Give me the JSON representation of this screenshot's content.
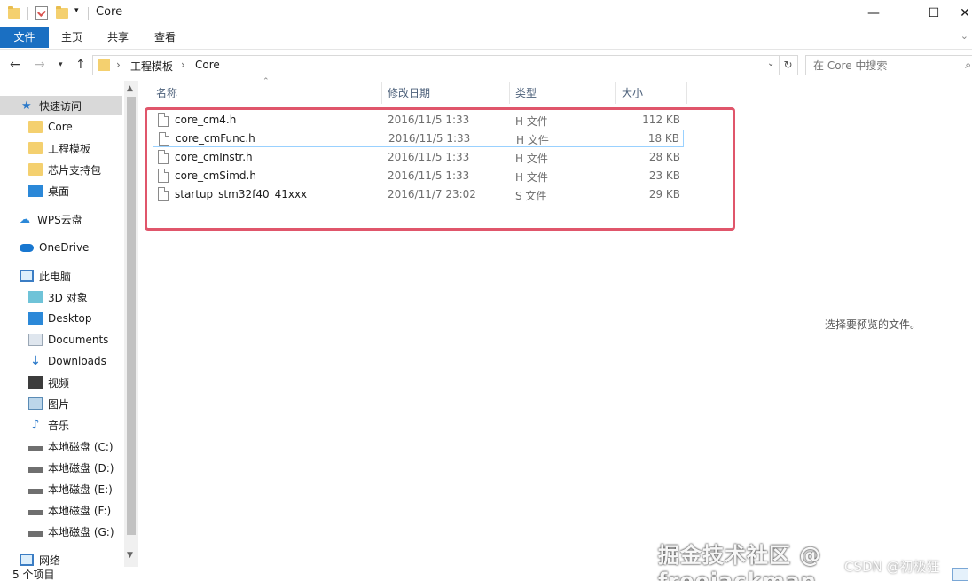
{
  "window": {
    "title": "Core",
    "controls": {
      "minimize": "—",
      "maximize": "☐",
      "close": "✕"
    }
  },
  "ribbon": {
    "tabs": [
      "文件",
      "主页",
      "共享",
      "查看"
    ]
  },
  "address": {
    "crumbs": [
      "工程模板",
      "Core"
    ],
    "search_placeholder": "在 Core 中搜索"
  },
  "sidebar": {
    "items": [
      {
        "label": "快速访问",
        "icon": "star-icon"
      },
      {
        "label": "Core",
        "icon": "folder-icon"
      },
      {
        "label": "工程模板",
        "icon": "folder-icon"
      },
      {
        "label": "芯片支持包",
        "icon": "folder-icon"
      },
      {
        "label": "桌面",
        "icon": "desktop-icon"
      },
      {
        "label": "WPS云盘",
        "icon": "cloud-icon"
      },
      {
        "label": "OneDrive",
        "icon": "onedrive-icon"
      },
      {
        "label": "此电脑",
        "icon": "pc-icon"
      },
      {
        "label": "3D 对象",
        "icon": "cube-icon"
      },
      {
        "label": "Desktop",
        "icon": "desktop-icon"
      },
      {
        "label": "Documents",
        "icon": "documents-icon"
      },
      {
        "label": "Downloads",
        "icon": "download-icon"
      },
      {
        "label": "视频",
        "icon": "video-icon"
      },
      {
        "label": "图片",
        "icon": "pictures-icon"
      },
      {
        "label": "音乐",
        "icon": "music-icon"
      },
      {
        "label": "本地磁盘 (C:)",
        "icon": "drive-icon"
      },
      {
        "label": "本地磁盘 (D:)",
        "icon": "drive-icon"
      },
      {
        "label": "本地磁盘 (E:)",
        "icon": "drive-icon"
      },
      {
        "label": "本地磁盘 (F:)",
        "icon": "drive-icon"
      },
      {
        "label": "本地磁盘 (G:)",
        "icon": "drive-icon"
      },
      {
        "label": "网络",
        "icon": "network-icon"
      }
    ]
  },
  "columns": {
    "name": "名称",
    "date": "修改日期",
    "type": "类型",
    "size": "大小"
  },
  "files": [
    {
      "name": "core_cm4.h",
      "date": "2016/11/5 1:33",
      "type": "H 文件",
      "size": "112 KB"
    },
    {
      "name": "core_cmFunc.h",
      "date": "2016/11/5 1:33",
      "type": "H 文件",
      "size": "18 KB"
    },
    {
      "name": "core_cmInstr.h",
      "date": "2016/11/5 1:33",
      "type": "H 文件",
      "size": "28 KB"
    },
    {
      "name": "core_cmSimd.h",
      "date": "2016/11/5 1:33",
      "type": "H 文件",
      "size": "23 KB"
    },
    {
      "name": "startup_stm32f40_41xxx",
      "date": "2016/11/7 23:02",
      "type": "S 文件",
      "size": "29 KB"
    }
  ],
  "preview": {
    "message": "选择要预览的文件。"
  },
  "status": {
    "count": "5 个项目"
  },
  "watermarks": {
    "primary": "掘金技术社区 @ freejackman",
    "secondary": "CSDN @初极狂"
  },
  "colors": {
    "accent": "#1a6fc2",
    "highlight_border": "#e0566b"
  }
}
